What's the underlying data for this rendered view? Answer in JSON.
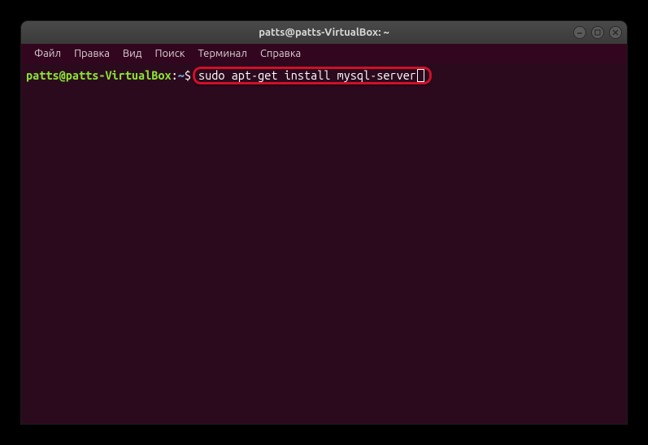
{
  "window": {
    "title": "patts@patts-VirtualBox: ~"
  },
  "menu": {
    "file": "Файл",
    "edit": "Правка",
    "view": "Вид",
    "search": "Поиск",
    "terminal": "Терминал",
    "help": "Справка"
  },
  "prompt": {
    "user_host": "patts@patts-VirtualBox",
    "colon": ":",
    "path": "~",
    "symbol": "$"
  },
  "command": "sudo apt-get install mysql-server"
}
